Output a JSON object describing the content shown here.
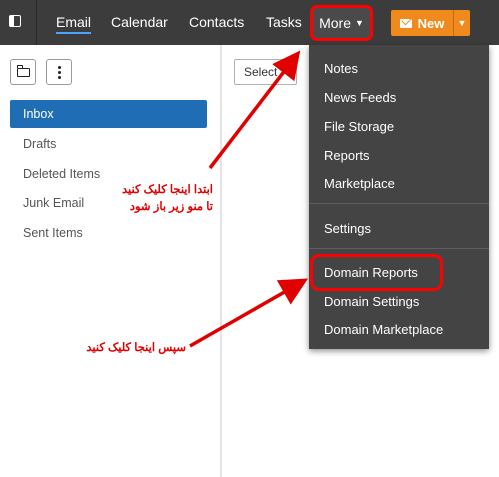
{
  "topbar": {
    "nav": [
      {
        "label": "Email",
        "active": true
      },
      {
        "label": "Calendar",
        "active": false
      },
      {
        "label": "Contacts",
        "active": false
      },
      {
        "label": "Tasks",
        "active": false
      }
    ],
    "more_label": "More",
    "new_label": "New",
    "icons": [
      "sidebar-toggle-icon",
      "envelope-icon",
      "caret-down-icon"
    ]
  },
  "left_pane": {
    "folders": [
      "Inbox",
      "Drafts",
      "Deleted Items",
      "Junk Email",
      "Sent Items"
    ],
    "selected": "Inbox",
    "icons": [
      "folder-icon",
      "kebab-menu-icon"
    ]
  },
  "middle": {
    "select_label": "Select"
  },
  "menu": {
    "group1": [
      "Notes",
      "News Feeds",
      "File Storage",
      "Reports",
      "Marketplace"
    ],
    "group2": [
      "Settings"
    ],
    "group3": [
      "Domain Reports",
      "Domain Settings",
      "Domain Marketplace"
    ]
  },
  "annotations": {
    "first_line1": "ابتدا اینجا کلیک کنید",
    "first_line2": "تا منو زیر باز شود",
    "second": "سپس اینجا کلیک کنید",
    "color": "#e00000"
  },
  "colors": {
    "topbar": "#3c3c3c",
    "menu": "#444444",
    "selected_folder": "#1e6db5",
    "new_button": "#f18a1d",
    "highlight": "#ff0000"
  }
}
